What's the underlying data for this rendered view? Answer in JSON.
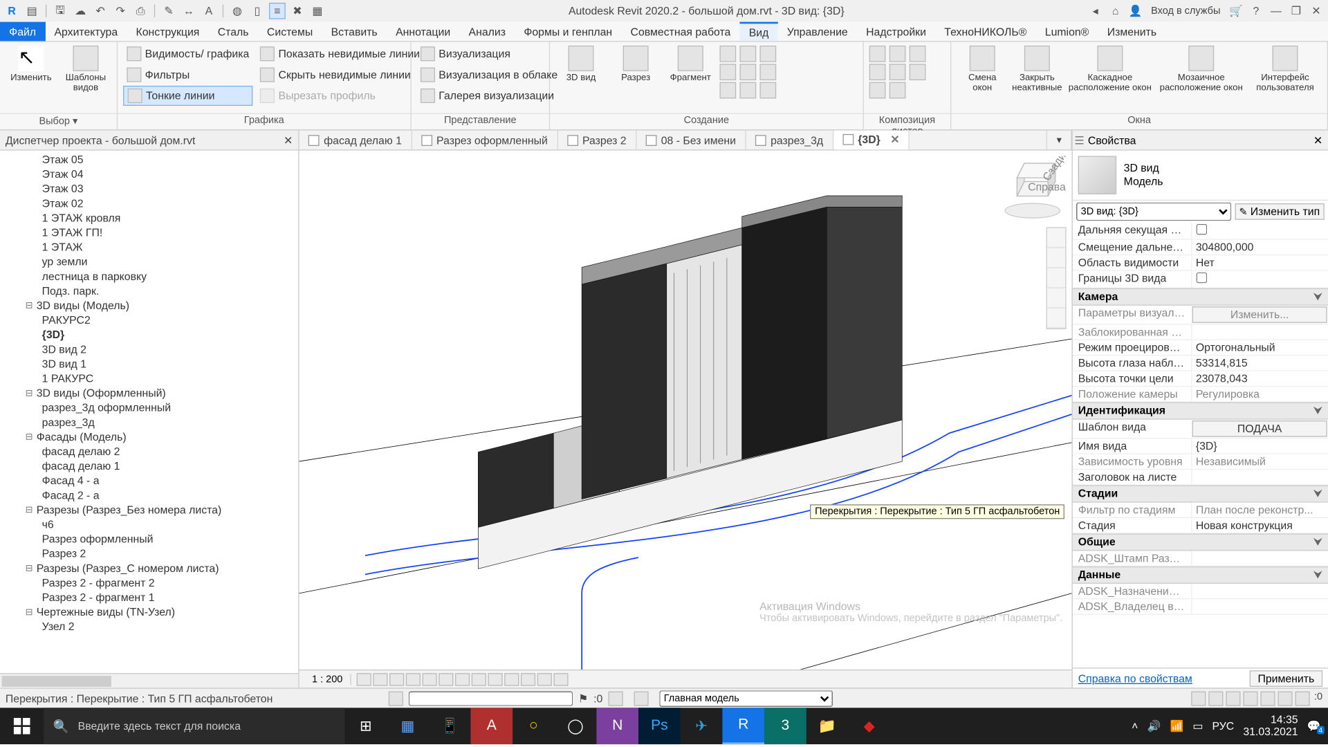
{
  "titlebar": {
    "app_title": "Autodesk Revit 2020.2 - большой дом.rvt - 3D вид: {3D}",
    "login_label": "Вход в службы",
    "icons_left": [
      "R",
      "open",
      "save",
      "saveas",
      "undo",
      "redo",
      "print",
      "measure",
      "dim",
      "text",
      "3d",
      "section",
      "props",
      "cut",
      "paste"
    ],
    "icons_right": [
      "info",
      "find",
      "user",
      "login",
      "cart",
      "help",
      "min",
      "max",
      "close"
    ]
  },
  "menubar": {
    "items": [
      "Файл",
      "Архитектура",
      "Конструкция",
      "Сталь",
      "Системы",
      "Вставить",
      "Аннотации",
      "Анализ",
      "Формы и генплан",
      "Совместная работа",
      "Вид",
      "Управление",
      "Надстройки",
      "ТехноНИКОЛЬ®",
      "Lumion®",
      "Изменить"
    ],
    "active_index": 10
  },
  "ribbon": {
    "panels": [
      {
        "label": "Выбор ▾",
        "big": [
          {
            "label": "Изменить"
          },
          {
            "label": "Шаблоны видов"
          }
        ],
        "small": []
      },
      {
        "label": "Графика",
        "small": [
          {
            "label": "Видимость/ графика"
          },
          {
            "label": "Фильтры"
          },
          {
            "label": "Тонкие линии",
            "toggled": true
          },
          {
            "label": "Показать невидимые линии"
          },
          {
            "label": "Скрыть невидимые линии"
          },
          {
            "label": "Вырезать профиль",
            "disabled": true
          },
          {
            "label": "Визуализация"
          },
          {
            "label": "Визуализация в облаке"
          },
          {
            "label": "Галерея  визуализации"
          }
        ]
      },
      {
        "label": "Представление"
      },
      {
        "label": "Создание",
        "big": [
          {
            "label": "3D вид"
          },
          {
            "label": "Разрез"
          },
          {
            "label": "Фрагмент"
          }
        ]
      },
      {
        "label": "Композиция листов"
      },
      {
        "label": "Окна",
        "big": [
          {
            "label": "Смена окон"
          },
          {
            "label": "Закрыть неактивные"
          },
          {
            "label": "Каскадное расположение окон"
          },
          {
            "label": "Мозаичное расположение окон"
          },
          {
            "label": "Интерфейс пользователя"
          }
        ]
      }
    ]
  },
  "browser": {
    "title": "Диспетчер проекта - большой дом.rvt",
    "nodes": [
      {
        "t": "item",
        "label": "Этаж 05"
      },
      {
        "t": "item",
        "label": "Этаж 04"
      },
      {
        "t": "item",
        "label": "Этаж 03"
      },
      {
        "t": "item",
        "label": "Этаж 02"
      },
      {
        "t": "item",
        "label": "1 ЭТАЖ кровля"
      },
      {
        "t": "item",
        "label": "1 ЭТАЖ ГП!"
      },
      {
        "t": "item",
        "label": "1 ЭТАЖ"
      },
      {
        "t": "item",
        "label": "ур земли"
      },
      {
        "t": "item",
        "label": "лестница в парковку"
      },
      {
        "t": "item",
        "label": "Подз. парк."
      },
      {
        "t": "cat",
        "label": "3D виды (Модель)",
        "open": true
      },
      {
        "t": "item",
        "label": "РАКУРС2"
      },
      {
        "t": "item",
        "label": "{3D}",
        "bold": true
      },
      {
        "t": "item",
        "label": "3D вид 2"
      },
      {
        "t": "item",
        "label": "3D вид 1"
      },
      {
        "t": "item",
        "label": "1 РАКУРС"
      },
      {
        "t": "cat",
        "label": "3D виды (Оформленный)",
        "open": true
      },
      {
        "t": "item",
        "label": "разрез_3д оформленный"
      },
      {
        "t": "item",
        "label": "разрез_3д"
      },
      {
        "t": "cat",
        "label": "Фасады (Модель)",
        "open": true
      },
      {
        "t": "item",
        "label": "фасад делаю 2"
      },
      {
        "t": "item",
        "label": "фасад делаю 1"
      },
      {
        "t": "item",
        "label": "Фасад 4 - а"
      },
      {
        "t": "item",
        "label": "Фасад 2 - а"
      },
      {
        "t": "cat",
        "label": "Разрезы (Разрез_Без номера листа)",
        "open": true
      },
      {
        "t": "item",
        "label": "ч6"
      },
      {
        "t": "item",
        "label": "Разрез оформленный"
      },
      {
        "t": "item",
        "label": "Разрез 2"
      },
      {
        "t": "cat",
        "label": "Разрезы (Разрез_С номером листа)",
        "open": true
      },
      {
        "t": "item",
        "label": "Разрез 2 - фрагмент 2"
      },
      {
        "t": "item",
        "label": "Разрез 2 - фрагмент 1"
      },
      {
        "t": "cat",
        "label": "Чертежные виды (TN-Узел)",
        "open": true
      },
      {
        "t": "item",
        "label": "Узел 2"
      }
    ]
  },
  "viewtabs": [
    {
      "label": "фасад делаю 1",
      "icon": "elev"
    },
    {
      "label": "Разрез оформленный",
      "icon": "section"
    },
    {
      "label": "Разрез 2",
      "icon": "section"
    },
    {
      "label": "08 - Без имени",
      "icon": "sheet"
    },
    {
      "label": "разрез_3д",
      "icon": "3d"
    },
    {
      "label": "{3D}",
      "icon": "3d",
      "active": true,
      "closeable": true
    }
  ],
  "viewctrl": {
    "scale_label": "1 : 200"
  },
  "canvas": {
    "hover_tooltip": "Перекрытия : Перекрытие : Тип 5 ГП асфальтобетон",
    "viewcube_faces": [
      "Справа",
      "Сзади"
    ]
  },
  "properties": {
    "title": "Свойства",
    "type_line1": "3D вид",
    "type_line2": "Модель",
    "selector_value": "3D вид: {3D}",
    "edit_type_label": "Изменить тип",
    "groups": [
      {
        "name": "__top__",
        "rows": [
          {
            "k": "Дальняя секущая Вкл",
            "v": "checkbox:false"
          },
          {
            "k": "Смещение дальнего ...",
            "v": "304800,000"
          },
          {
            "k": "Область видимости",
            "v": "Нет"
          },
          {
            "k": "Границы 3D вида",
            "v": "checkbox:false"
          }
        ]
      },
      {
        "name": "Камера",
        "rows": [
          {
            "k": "Параметры визуализ...",
            "v": "btn:Изменить...",
            "ro": true
          },
          {
            "k": "Заблокированная ор...",
            "v": "",
            "ro": true
          },
          {
            "k": "Режим проецирован...",
            "v": "Ортогональный"
          },
          {
            "k": "Высота глаза наблю...",
            "v": "53314,815"
          },
          {
            "k": "Высота точки цели",
            "v": "23078,043"
          },
          {
            "k": "Положение камеры",
            "v": "Регулировка",
            "ro": true
          }
        ]
      },
      {
        "name": "Идентификация",
        "rows": [
          {
            "k": "Шаблон вида",
            "v": "btn:ПОДАЧА"
          },
          {
            "k": "Имя вида",
            "v": "{3D}"
          },
          {
            "k": "Зависимость уровня",
            "v": "Независимый",
            "ro": true
          },
          {
            "k": "Заголовок на листе",
            "v": ""
          }
        ]
      },
      {
        "name": "Стадии",
        "rows": [
          {
            "k": "Фильтр по стадиям",
            "v": "План после реконстр...",
            "ro": true
          },
          {
            "k": "Стадия",
            "v": "Новая конструкция"
          }
        ]
      },
      {
        "name": "Общие",
        "rows": [
          {
            "k": "ADSK_Штамп Раздел ...",
            "v": "",
            "ro": true
          }
        ]
      },
      {
        "name": "Данные",
        "rows": [
          {
            "k": "ADSK_Назначение в...",
            "v": "",
            "ro": true
          },
          {
            "k": "ADSK_Владелец вида",
            "v": "",
            "ro": true
          }
        ]
      }
    ],
    "help_link": "Справка по свойствам",
    "apply_label": "Применить"
  },
  "statusbar": {
    "selection_text": "Перекрытия : Перекрытие : Тип 5 ГП асфальтобетон",
    "excluded_label": ":0",
    "main_model_label": "Главная модель",
    "filter_count": ":0"
  },
  "watermark": {
    "line1": "Активация Windows",
    "line2": "Чтобы активировать Windows, перейдите в раздел \"Параметры\"."
  },
  "taskbar": {
    "search_placeholder": "Введите здесь текст для поиска",
    "lang": "РУС",
    "time": "14:35",
    "date": "31.03.2021",
    "notif_badge": "4"
  }
}
